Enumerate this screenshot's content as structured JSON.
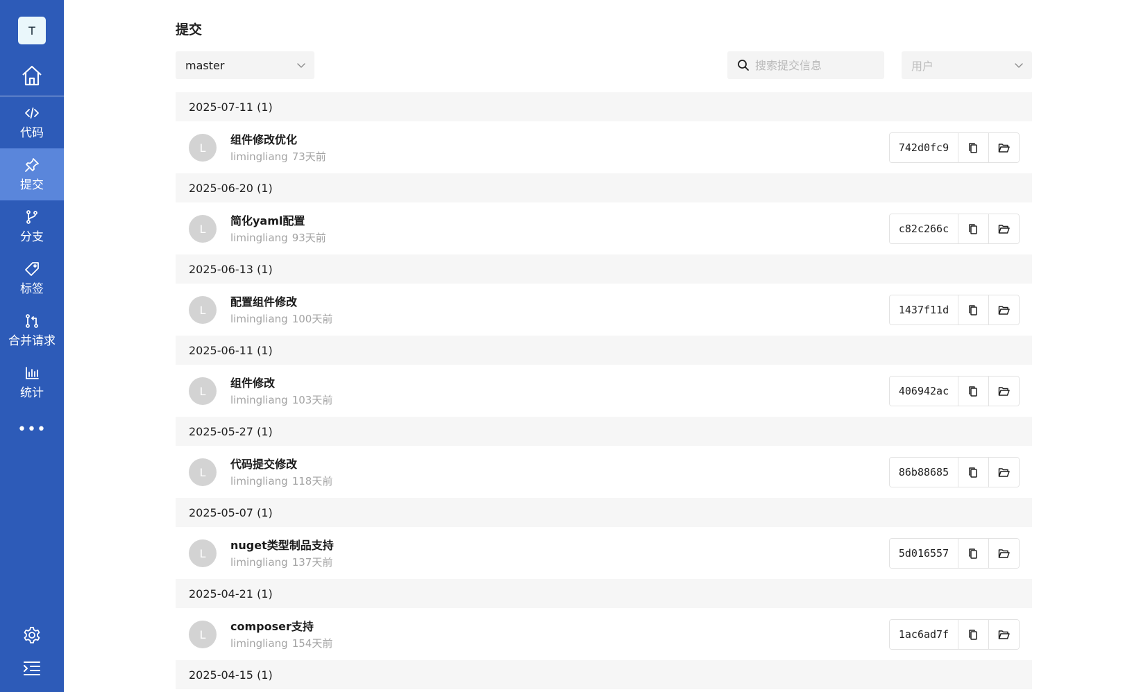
{
  "sidebar": {
    "avatar_letter": "T",
    "nav": [
      {
        "icon": "code-icon",
        "label": "代码"
      },
      {
        "icon": "pin-icon",
        "label": "提交",
        "active": true
      },
      {
        "icon": "branch-icon",
        "label": "分支"
      },
      {
        "icon": "tag-icon",
        "label": "标签"
      },
      {
        "icon": "merge-request-icon",
        "label": "合并请求"
      },
      {
        "icon": "bar-chart-icon",
        "label": "统计"
      }
    ],
    "more_label": "•••"
  },
  "page": {
    "title": "提交"
  },
  "toolbar": {
    "branch": "master",
    "search_placeholder": "搜索提交信息",
    "user_placeholder": "用户"
  },
  "groups": [
    {
      "date": "2025-07-11 (1)",
      "commits": [
        {
          "avatar": "L",
          "message": "组件修改优化",
          "author": "limingliang",
          "time": "73天前",
          "sha": "742d0fc9"
        }
      ]
    },
    {
      "date": "2025-06-20 (1)",
      "commits": [
        {
          "avatar": "L",
          "message": "简化yaml配置",
          "author": "limingliang",
          "time": "93天前",
          "sha": "c82c266c"
        }
      ]
    },
    {
      "date": "2025-06-13 (1)",
      "commits": [
        {
          "avatar": "L",
          "message": "配置组件修改",
          "author": "limingliang",
          "time": "100天前",
          "sha": "1437f11d"
        }
      ]
    },
    {
      "date": "2025-06-11 (1)",
      "commits": [
        {
          "avatar": "L",
          "message": "组件修改",
          "author": "limingliang",
          "time": "103天前",
          "sha": "406942ac"
        }
      ]
    },
    {
      "date": "2025-05-27 (1)",
      "commits": [
        {
          "avatar": "L",
          "message": "代码提交修改",
          "author": "limingliang",
          "time": "118天前",
          "sha": "86b88685"
        }
      ]
    },
    {
      "date": "2025-05-07 (1)",
      "commits": [
        {
          "avatar": "L",
          "message": "nuget类型制品支持",
          "author": "limingliang",
          "time": "137天前",
          "sha": "5d016557"
        }
      ]
    },
    {
      "date": "2025-04-21 (1)",
      "commits": [
        {
          "avatar": "L",
          "message": "composer支持",
          "author": "limingliang",
          "time": "154天前",
          "sha": "1ac6ad7f"
        }
      ]
    },
    {
      "date": "2025-04-15 (1)",
      "commits": []
    }
  ],
  "colors": {
    "sidebar": "#2d5bb8",
    "sidebar_active": "#5a86db"
  }
}
